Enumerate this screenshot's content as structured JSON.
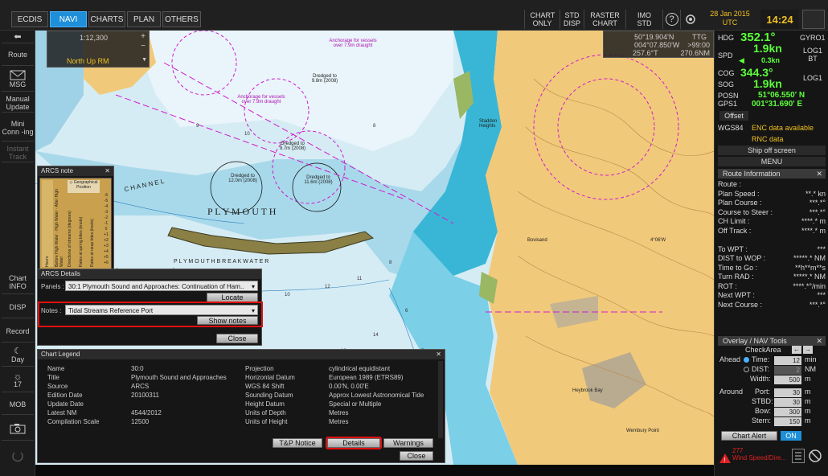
{
  "topbar": {
    "tabs": [
      "ECDIS",
      "NAVI",
      "CHARTS",
      "PLAN",
      "OTHERS"
    ],
    "active_tab": "NAVI",
    "chart_only": "CHART ONLY",
    "std_disp": "STD DISP",
    "raster_chart": "RASTER CHART",
    "imo_std": "IMO STD",
    "help": "?",
    "date": "28 Jan 2015",
    "tz": "UTC",
    "time": "14:24"
  },
  "leftbar": {
    "route": "Route",
    "msg": "MSG",
    "manual_update": "Manual Update",
    "mini_conning": "Mini Conn -ing",
    "instant_track": "Instant Track",
    "chart_info": "Chart INFO",
    "disp": "DISP",
    "record": "Record",
    "day": "Day",
    "brightness": "17",
    "mob": "MOB"
  },
  "chart": {
    "scale": "1:12,300",
    "orientation": "North Up RM",
    "cursor_lat": "50°19.904'N",
    "cursor_lon": "004°07.850'W",
    "ttg_label": "TTG",
    "ttg_value": ">99:00",
    "bearing": "257.6°T",
    "range": "270.6NM",
    "labels": {
      "plymouth": "P L Y M O U T H",
      "breakwater": "P L Y M O U T H   B R E A K W A T E R",
      "channel": "C H A N N E L",
      "dredged_1": "Dredged to 12.0m (2008)",
      "dredged_2": "Dredged to 11.6m (2008)",
      "dredged_3": "Dredged to 9.8m (2008)",
      "dredged_4": "Dredged to 9.7m (2008)",
      "anchorage_1": "Anchorage for vessels over 7.9m draught",
      "anchorage_2": "Anchorage for vessels over 7.9m draught",
      "lon_label": "4°06'W",
      "staddon": "Staddon Heights",
      "heybrook": "Heybrook Bay",
      "wembury": "Wembury Point",
      "bovisand": "Bovisand"
    }
  },
  "arcs_note": {
    "title": "ARCS note",
    "hours": "Hours",
    "geo_pos": "Geographical Position",
    "before_hw": "Before High Water",
    "high_water": "High Water",
    "after_hw": "After High Water",
    "dir_streams": "Directions of streams (degrees)",
    "rates_spring": "Rates at spring tides (knots)",
    "rates_neap": "Rates at neap tides (knots)",
    "hour_nums": [
      "-6",
      "-5",
      "-4",
      "-3",
      "-2",
      "-1",
      "0",
      "+1",
      "+2",
      "+3",
      "+4",
      "+5",
      "+6"
    ]
  },
  "arcs_details": {
    "title": "ARCS Details",
    "panels_label": "Panels :",
    "panels_value": "30:1 Plymouth Sound and Approaches: Continuation of Ham..",
    "locate": "Locate",
    "notes_label": "Notes :",
    "notes_value": "Tidal Streams Reference Port",
    "show_notes": "Show notes",
    "close": "Close"
  },
  "legend": {
    "title": "Chart Legend",
    "left": [
      [
        "Name",
        "30:0"
      ],
      [
        "Title",
        "Plymouth Sound and Approaches"
      ],
      [
        "Source",
        "ARCS"
      ],
      [
        "Edition Date",
        "20100311"
      ],
      [
        "Update Date",
        ""
      ],
      [
        "Latest NM",
        "4544/2012"
      ],
      [
        "Compilation Scale",
        "12500"
      ]
    ],
    "right": [
      [
        "Projection",
        "cylindrical equidistant"
      ],
      [
        "Horizontal Datum",
        "European 1989 (ETRS89)"
      ],
      [
        "WGS 84 Shift",
        "0.00'N, 0.00'E"
      ],
      [
        "Sounding Datum",
        "Approx Lowest Astronomical Tide"
      ],
      [
        "Height Datum",
        "Special or Multiple"
      ],
      [
        "Units of Depth",
        "Metres"
      ],
      [
        "Units of Height",
        "Metres"
      ]
    ],
    "tp_notice": "T&P Notice",
    "details": "Details",
    "warnings": "Warnings",
    "close": "Close"
  },
  "right": {
    "hdg_label": "HDG",
    "hdg": "352.1°",
    "gyro": "GYRO1",
    "spd_label": "SPD",
    "spd": "1.9kn",
    "spd_cross": "0.3kn",
    "log1bt": "LOG1 BT",
    "cog_label": "COG",
    "cog": "344.3°",
    "sog_label": "SOG",
    "sog": "1.9kn",
    "log1": "LOG1",
    "posn_label": "POSN",
    "gps_label": "GPS1",
    "lat": "51°06.550' N",
    "lon": "001°31.690' E",
    "offset": "Offset",
    "wgs84": "WGS84",
    "enc": "ENC data available",
    "rnc": "RNC data",
    "ship_off": "Ship off screen",
    "menu": "MENU",
    "route_info": "Route Information",
    "route_rows": [
      [
        "Route :",
        ""
      ],
      [
        "Plan Speed :",
        "**.* kn"
      ],
      [
        "Plan Course :",
        "***.*°"
      ],
      [
        "Course to Steer :",
        "***.*°"
      ],
      [
        "CH Limit :",
        "****.* m"
      ],
      [
        "Off Track :",
        "****.* m"
      ],
      [
        "",
        ""
      ],
      [
        "To WPT :",
        "***"
      ],
      [
        "DIST to WOP :",
        "*****.* NM"
      ],
      [
        "Time to Go :",
        "**h**m**s"
      ],
      [
        "Turn RAD :",
        "*****.* NM"
      ],
      [
        "ROT :",
        "****.*°/min"
      ],
      [
        "Next WPT :",
        "***"
      ],
      [
        "Next Course :",
        "***.*°"
      ]
    ],
    "overlay": "Overlay / NAV Tools",
    "check_area": "CheckArea",
    "ahead": "Ahead",
    "time_label": "Time:",
    "time_val": "12",
    "time_unit": "min",
    "dist_label": "DIST:",
    "dist_val": "2",
    "dist_unit": "NM",
    "width_label": "Width:",
    "width_val": "500",
    "width_unit": "m",
    "around": "Around",
    "port_label": "Port:",
    "port_val": "30",
    "stbd_label": "STBD:",
    "stbd_val": "30",
    "bow_label": "Bow:",
    "bow_val": "300",
    "stern_label": "Stern:",
    "stern_val": "150",
    "m": "m",
    "chart_alert": "Chart Alert",
    "on": "ON",
    "alarm_code": "277",
    "alarm_text": "Wind Speed/Dire..."
  }
}
